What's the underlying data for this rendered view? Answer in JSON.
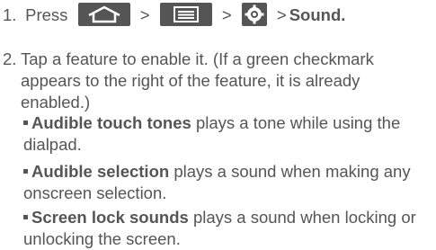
{
  "steps": [
    {
      "number": "1.",
      "press": "Press",
      "separator": ">",
      "keys": [
        "home-key-icon",
        "menu-key-icon",
        "settings-icon"
      ],
      "target": "Sound",
      "end": "."
    },
    {
      "number": "2.",
      "text": "Tap a feature to enable it. (If a green checkmark appears to the right of the feature, it is already enabled.)"
    }
  ],
  "features": [
    {
      "name": "Audible touch tones",
      "description": "plays a tone while using the dialpad."
    },
    {
      "name": "Audible selection",
      "description": "plays a sound when making any onscreen selection."
    },
    {
      "name": "Screen lock sounds",
      "description": "plays a sound when locking or unlocking the screen."
    }
  ],
  "colors": {
    "text": "#555555",
    "key_background": "#555555"
  }
}
